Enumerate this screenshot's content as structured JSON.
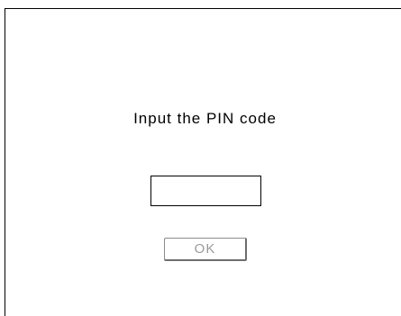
{
  "dialog": {
    "prompt": "Input the PIN code",
    "pin_input": {
      "value": "",
      "placeholder": ""
    },
    "ok_button": {
      "label": "OK",
      "state": "disabled"
    }
  },
  "colors": {
    "background": "#ffffff",
    "border": "#000000",
    "disabled_text": "#9a9a9a"
  }
}
